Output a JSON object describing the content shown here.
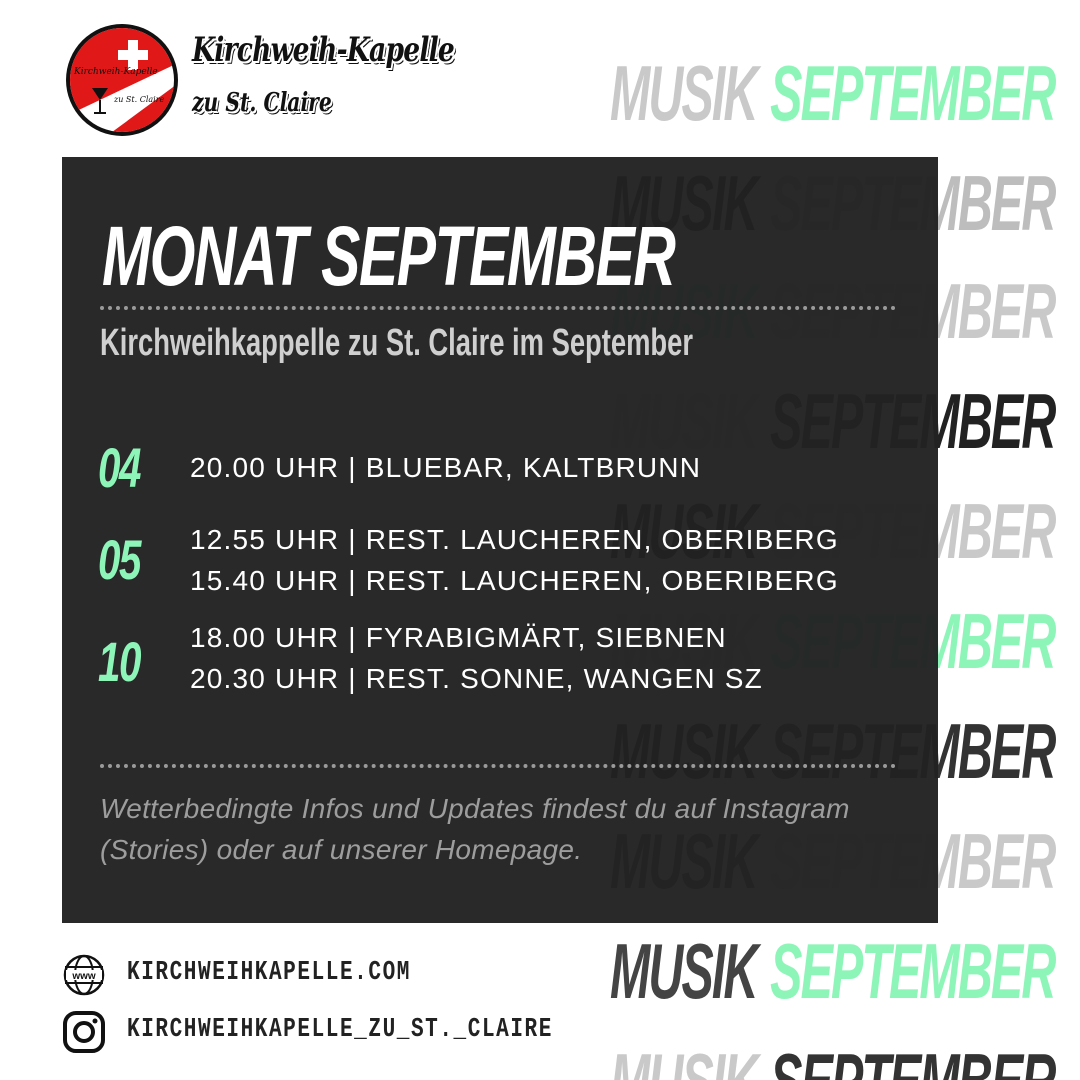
{
  "background": {
    "word_a": "MUSIK",
    "word_b": "SEPTEMBER"
  },
  "brand": {
    "name": "Kirchweih-Kapelle",
    "sub": "zu St. Claire",
    "logo_text_top": "Kirchweih-Kapelle",
    "logo_text_bottom": "zu St. Claire"
  },
  "card": {
    "title": "MONAT SEPTEMBER",
    "subtitle": "Kirchweihkappelle zu St. Claire  im September",
    "events": [
      {
        "day": "04",
        "lines": [
          "20.00 UHR | BLUEBAR, KALTBRUNN"
        ]
      },
      {
        "day": "05",
        "lines": [
          "12.55 UHR | REST. LAUCHEREN, OBERIBERG",
          "15.40 UHR | REST. LAUCHEREN, OBERIBERG"
        ]
      },
      {
        "day": "10",
        "lines": [
          "18.00 UHR | FYRABIGMÄRT, SIEBNEN",
          "20.30 UHR | REST. SONNE, WANGEN SZ"
        ]
      }
    ],
    "note": "Wetterbedingte Infos und Updates findest du auf Instagram (Stories) oder auf unserer Homepage."
  },
  "contacts": {
    "website": "KIRCHWEIHKAPELLE.COM",
    "instagram": "KIRCHWEIHKAPELLE_ZU_ST._CLAIRE",
    "website_icon": "globe-www-icon",
    "instagram_icon": "instagram-icon"
  },
  "colors": {
    "accent_green": "#8ef5b8",
    "card_bg": "#222222",
    "logo_red": "#e01818"
  }
}
